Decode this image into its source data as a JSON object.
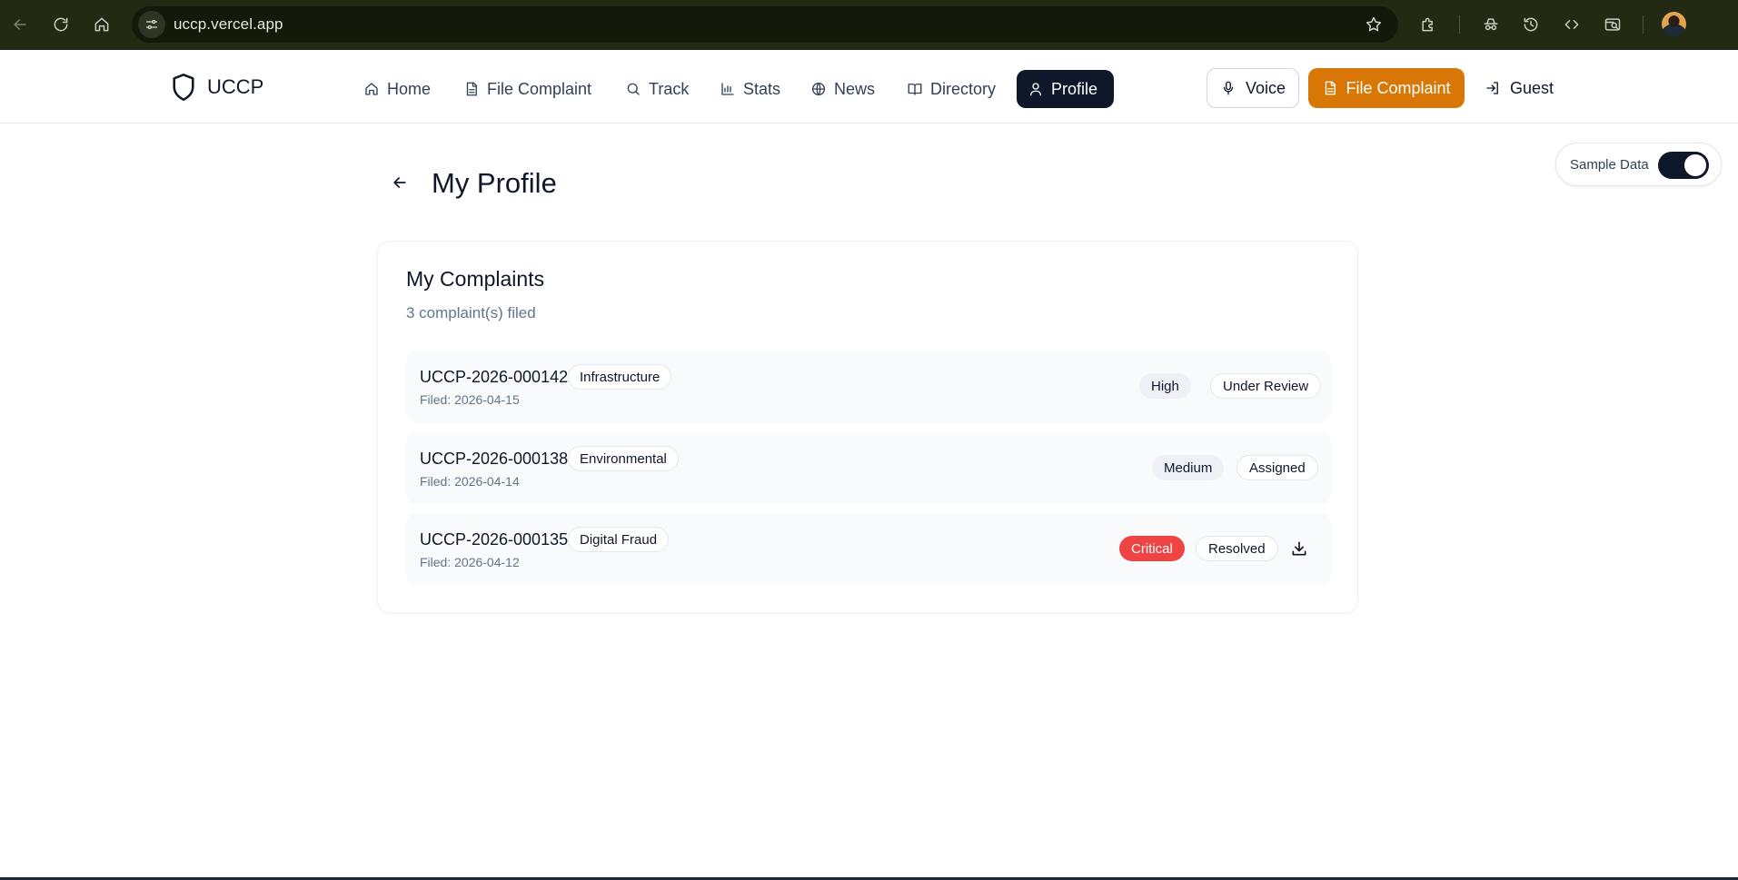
{
  "browser": {
    "url": "uccp.vercel.app",
    "icons": [
      "back-icon",
      "reload-icon",
      "home-icon",
      "site-info-icon",
      "star-icon",
      "extensions-icon",
      "incognito-icon",
      "history-icon",
      "code-icon",
      "tab-search-icon"
    ]
  },
  "nav": {
    "brand": "UCCP",
    "items": [
      {
        "label": "Home",
        "icon": "home-icon"
      },
      {
        "label": "File Complaint",
        "icon": "file-icon"
      },
      {
        "label": "Track",
        "icon": "search-icon"
      },
      {
        "label": "Stats",
        "icon": "bar-chart-icon"
      },
      {
        "label": "News",
        "icon": "globe-icon"
      },
      {
        "label": "Directory",
        "icon": "book-icon"
      },
      {
        "label": "Profile",
        "icon": "user-icon",
        "active": true
      }
    ],
    "voice": "Voice",
    "cta": "File Complaint",
    "guest": "Guest"
  },
  "sample_toggle": {
    "label": "Sample Data",
    "on": true
  },
  "page": {
    "title": "My Profile"
  },
  "complaints": {
    "title": "My Complaints",
    "subtitle": "3 complaint(s) filed",
    "rows": [
      {
        "id": "UCCP-2026-000142",
        "category": "Infrastructure",
        "filed": "Filed: 2026-04-15",
        "priority": "High",
        "status": "Under Review"
      },
      {
        "id": "UCCP-2026-000138",
        "category": "Environmental",
        "filed": "Filed: 2026-04-14",
        "priority": "Medium",
        "status": "Assigned"
      },
      {
        "id": "UCCP-2026-000135",
        "category": "Digital Fraud",
        "filed": "Filed: 2026-04-12",
        "priority": "Critical",
        "status": "Resolved"
      }
    ]
  },
  "colors": {
    "browser_bar": "#232a14",
    "nav_active": "#0f172a",
    "cta": "#d97706",
    "critical": "#ef4444"
  }
}
